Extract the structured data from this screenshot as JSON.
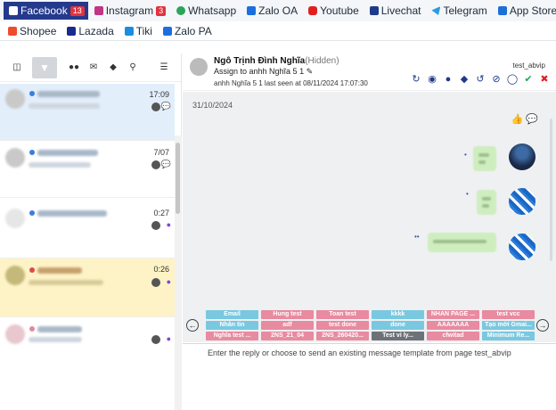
{
  "channels_row1": [
    {
      "label": "Facebook",
      "badge": "13",
      "active": true,
      "icon": "facebook-icon",
      "color": "#ffffff"
    },
    {
      "label": "Instagram",
      "badge": "3",
      "active": false,
      "icon": "instagram-icon",
      "color": "#c13584"
    },
    {
      "label": "Whatsapp",
      "badge": "",
      "active": false,
      "icon": "whatsapp-icon",
      "color": "#2aa55a"
    },
    {
      "label": "Zalo OA",
      "badge": "",
      "active": false,
      "icon": "zalo-icon",
      "color": "#1d6fe0"
    },
    {
      "label": "Youtube",
      "badge": "",
      "active": false,
      "icon": "youtube-icon",
      "color": "#e02020"
    },
    {
      "label": "Livechat",
      "badge": "",
      "active": false,
      "icon": "livechat-icon",
      "color": "#1e3a8a"
    },
    {
      "label": "Telegram",
      "badge": "",
      "active": false,
      "icon": "telegram-icon",
      "color": "#2b9be0"
    },
    {
      "label": "App Store",
      "badge": "",
      "active": false,
      "icon": "app-store-icon",
      "color": "#1e6fd9"
    }
  ],
  "channels_row2": [
    {
      "label": "Shopee",
      "icon": "shopee-icon",
      "color": "#ee4d2d"
    },
    {
      "label": "Lazada",
      "icon": "lazada-icon",
      "color": "#1a2a8f"
    },
    {
      "label": "Tiki",
      "icon": "tiki-icon",
      "color": "#1a8de0"
    },
    {
      "label": "Zalo PA",
      "icon": "zalo-pa-icon",
      "color": "#1d6fe0"
    }
  ],
  "conversations": [
    {
      "time": "17:09",
      "selected": true,
      "highlight": false,
      "dot": "#3b7ddd",
      "channel_icon": "comment-icon"
    },
    {
      "time": "7/07",
      "selected": false,
      "highlight": false,
      "dot": "#3b7ddd",
      "channel_icon": "comment-icon"
    },
    {
      "time": "0:27",
      "selected": false,
      "highlight": false,
      "dot": "#3b7ddd",
      "channel_icon": "messenger-icon"
    },
    {
      "time": "0:26",
      "selected": false,
      "highlight": true,
      "dot": "#e04848",
      "channel_icon": "messenger-icon"
    },
    {
      "time": "",
      "selected": false,
      "highlight": false,
      "dot": "#e08aa0",
      "channel_icon": "messenger-icon"
    }
  ],
  "chat": {
    "name": "Ngô Trịnh Đình Nghĩa",
    "hidden_tag": "(Hidden)",
    "assign": "Assign to anhh Nghĩa 5 1",
    "last_seen": "anhh Nghĩa 5 1 last seen at 08/11/2024 17:07:30",
    "page_tag": "test_abvip",
    "date": "31/10/2024"
  },
  "quick_replies": [
    {
      "label": "Email",
      "color": "#7ac8e0"
    },
    {
      "label": "Hung test",
      "color": "#e88aa0"
    },
    {
      "label": "Toan test",
      "color": "#e88aa0"
    },
    {
      "label": "kkkk",
      "color": "#7ac8e0"
    },
    {
      "label": "NHAN PAGE ...",
      "color": "#e88aa0"
    },
    {
      "label": "test vcc",
      "color": "#e88aa0"
    },
    {
      "label": "Nhân tin",
      "color": "#7ac8e0"
    },
    {
      "label": "adf",
      "color": "#e88aa0"
    },
    {
      "label": "test done",
      "color": "#e88aa0"
    },
    {
      "label": "done",
      "color": "#7ac8e0"
    },
    {
      "label": "AAAAAAA",
      "color": "#e88aa0"
    },
    {
      "label": "Tạo mới Gmai...",
      "color": "#7ac8e0"
    },
    {
      "label": "Nghĩa test ...",
      "color": "#e88aa0"
    },
    {
      "label": "2NS_21_04",
      "color": "#e88aa0"
    },
    {
      "label": "2NS_260420...",
      "color": "#e88aa0"
    },
    {
      "label": "Test vì ly...",
      "color": "#6d7278"
    },
    {
      "label": "cfwitad",
      "color": "#e88aa0"
    },
    {
      "label": "Minimum Re...",
      "color": "#7ac8e0"
    }
  ],
  "compose_placeholder": "Enter the reply or choose to send an existing message template from page test_abvip"
}
